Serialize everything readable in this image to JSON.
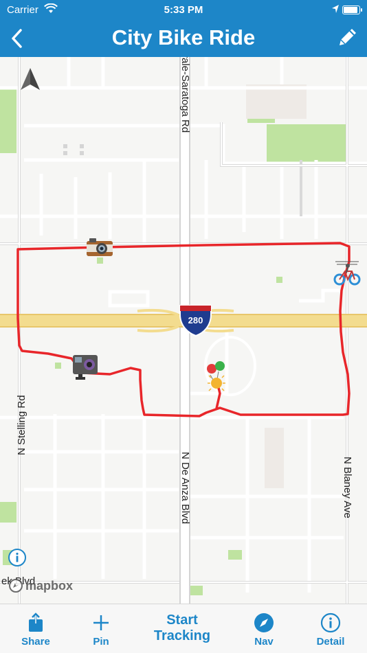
{
  "status_bar": {
    "carrier": "Carrier",
    "time": "5:33 PM",
    "battery_level": 1.0
  },
  "nav": {
    "title": "City Bike Ride",
    "back_icon": "chevron-left-icon",
    "edit_icon": "pencil-icon"
  },
  "map": {
    "road_labels": {
      "sunnyvale": "yvale-Saratoga Rd",
      "stelling": "N Stelling Rd",
      "de_anza": "N De Anza Blvd",
      "blaney": "N Blaney Ave",
      "creek": "ek Blvd"
    },
    "highway_shield": "280",
    "attribution": "mapbox",
    "route_color": "#e8262a",
    "markers": [
      "camera-icon",
      "action-camera-icon",
      "balloons-icon",
      "bicycle-icon"
    ]
  },
  "tabs": {
    "share": "Share",
    "pin": "Pin",
    "start_tracking": "Start Tracking",
    "nav": "Nav",
    "detail": "Detail"
  },
  "colors": {
    "accent": "#1d86c8",
    "highway": "#f0d98a",
    "park": "#bfe3a0"
  }
}
